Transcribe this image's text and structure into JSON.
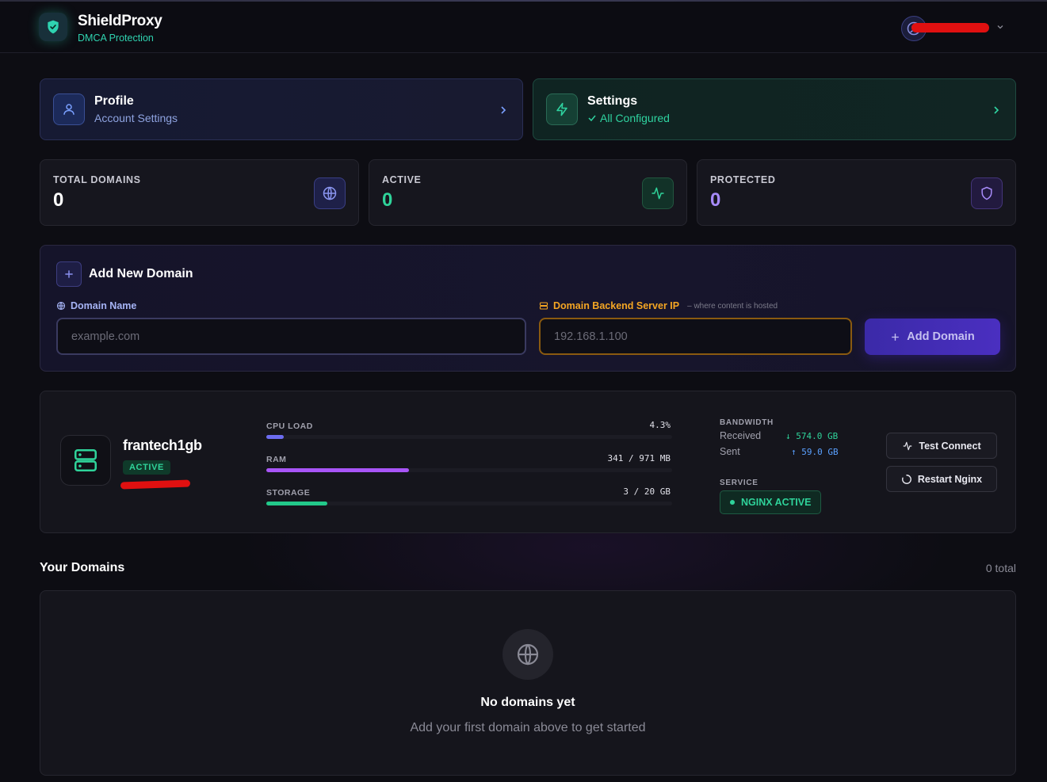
{
  "header": {
    "brand_title": "ShieldProxy",
    "brand_subtitle": "DMCA Protection",
    "user_icon": "user-circle-icon"
  },
  "nav_cards": {
    "profile": {
      "title": "Profile",
      "subtitle": "Account Settings",
      "icon": "user-icon"
    },
    "settings": {
      "title": "Settings",
      "subtitle": "All Configured",
      "icon": "lightning-icon"
    }
  },
  "stats": [
    {
      "label": "TOTAL DOMAINS",
      "value": "0",
      "color": "#ffffff",
      "icon": "globe-icon"
    },
    {
      "label": "ACTIVE",
      "value": "0",
      "color": "#2fd39a",
      "icon": "activity-icon"
    },
    {
      "label": "PROTECTED",
      "value": "0",
      "color": "#a78bfa",
      "icon": "shield-icon"
    }
  ],
  "add_domain": {
    "title": "Add New Domain",
    "domain_label": "Domain Name",
    "domain_placeholder": "example.com",
    "domain_value": "",
    "ip_label": "Domain Backend Server IP",
    "ip_hint": "– where content is hosted",
    "ip_placeholder": "192.168.1.100",
    "ip_value": "",
    "button_label": "Add Domain"
  },
  "server": {
    "name": "frantech1gb",
    "status": "ACTIVE",
    "metrics": [
      {
        "label": "CPU LOAD",
        "value": "4.3%",
        "fraction": 0.043,
        "color": "#6c6cf0"
      },
      {
        "label": "RAM",
        "value": "341 / 971 MB",
        "fraction": 0.351,
        "color": "#a855f7"
      },
      {
        "label": "STORAGE",
        "value": "3 / 20 GB",
        "fraction": 0.15,
        "color": "#22c98a"
      }
    ],
    "bandwidth": {
      "heading": "BANDWIDTH",
      "received_label": "Received",
      "received_value": "↓ 574.0 GB",
      "sent_label": "Sent",
      "sent_value": "↑ 59.0 GB"
    },
    "service_heading": "SERVICE",
    "service_status": "NGINX ACTIVE",
    "test_button": "Test Connect",
    "restart_button": "Restart Nginx"
  },
  "domains": {
    "title": "Your Domains",
    "count": "0 total",
    "empty_title": "No domains yet",
    "empty_subtitle": "Add your first domain above to get started"
  }
}
